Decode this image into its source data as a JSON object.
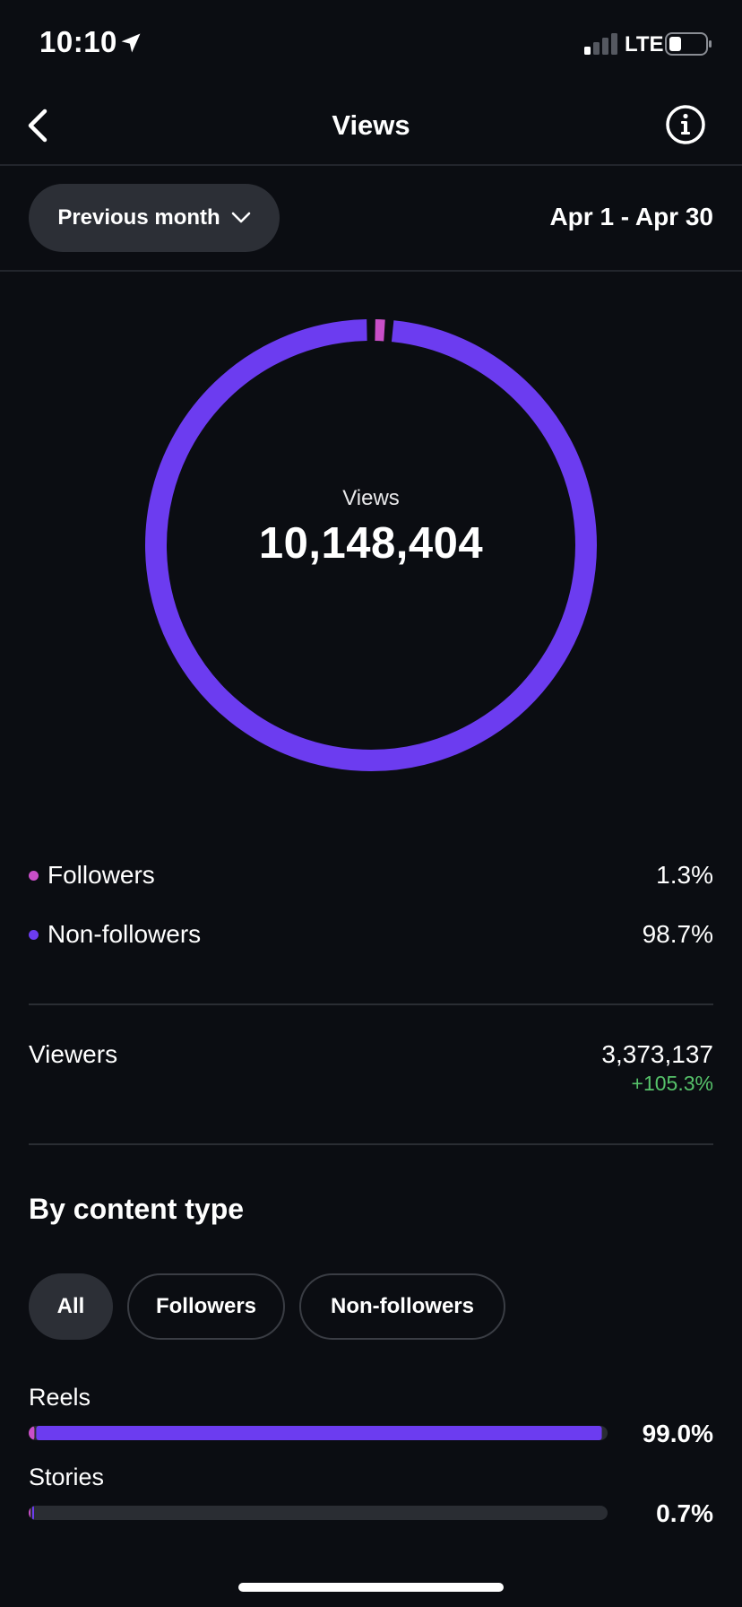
{
  "status_bar": {
    "time": "10:10",
    "network": "LTE"
  },
  "header": {
    "title": "Views"
  },
  "period": {
    "selector_label": "Previous month",
    "date_range": "Apr 1 - Apr 30"
  },
  "summary": {
    "label": "Views",
    "total": "10,148,404",
    "segments": [
      {
        "name": "Followers",
        "percent": 1.3,
        "percent_label": "1.3%",
        "color": "#c94fc8"
      },
      {
        "name": "Non-followers",
        "percent": 98.7,
        "percent_label": "98.7%",
        "color": "#6c3cf0"
      }
    ]
  },
  "viewers": {
    "label": "Viewers",
    "value": "3,373,137",
    "change": "+105.3%"
  },
  "content_type": {
    "title": "By content type",
    "filters": [
      "All",
      "Followers",
      "Non-followers"
    ],
    "active_filter": "All",
    "items": [
      {
        "label": "Reels",
        "percent": 99.0,
        "percent_label": "99.0%",
        "followers_share": 0.01
      },
      {
        "label": "Stories",
        "percent": 0.7,
        "percent_label": "0.7%",
        "followers_share": 0.3
      }
    ]
  },
  "colors": {
    "accent_purple": "#6c3cf0",
    "accent_pink": "#c94fc8",
    "positive_green": "#56c26a",
    "background": "#0b0d12"
  }
}
